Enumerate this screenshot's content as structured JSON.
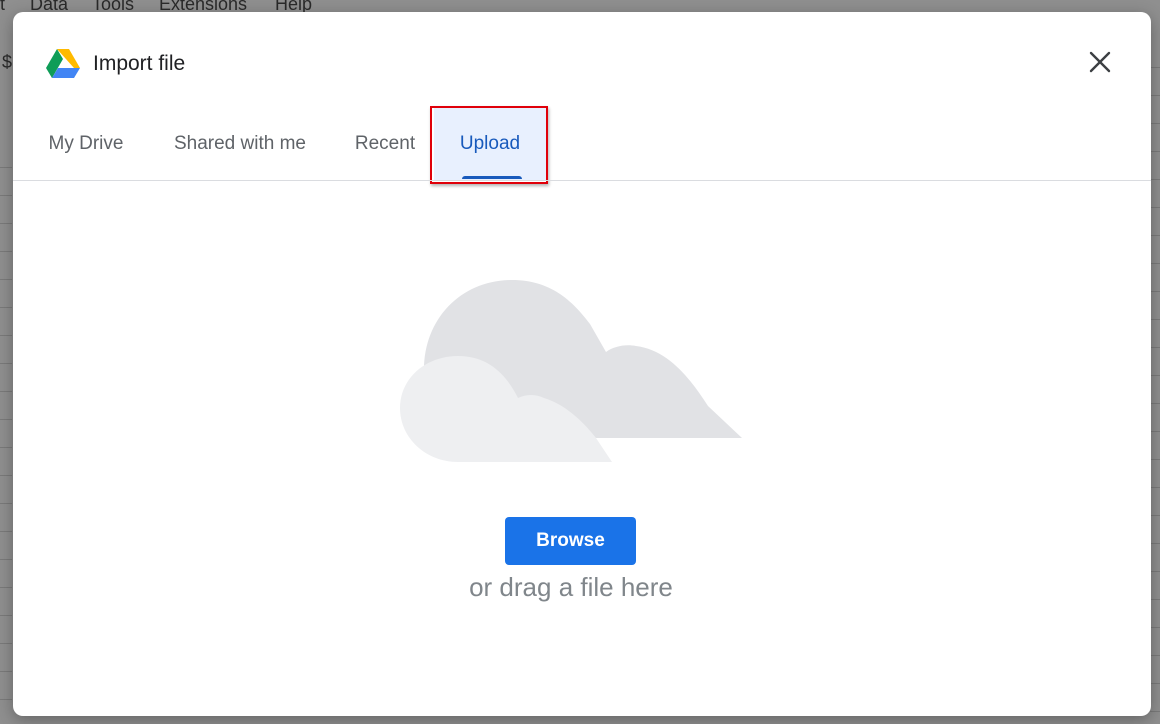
{
  "background_app": {
    "menu": [
      "t",
      "Data",
      "Tools",
      "Extensions",
      "Help"
    ],
    "side_glyph": "$"
  },
  "dialog": {
    "title": "Import file",
    "logo_icon": "google-drive-icon",
    "close_icon": "close-icon",
    "tabs": [
      {
        "label": "My Drive",
        "active": false
      },
      {
        "label": "Shared with me",
        "active": false
      },
      {
        "label": "Recent",
        "active": false
      },
      {
        "label": "Upload",
        "active": true
      }
    ],
    "upload": {
      "illustration": "cloud-illustration",
      "browse_label": "Browse",
      "drag_text": "or drag a file here"
    }
  },
  "colors": {
    "accent": "#1a73e8",
    "active_tab_text": "#185abc",
    "active_tab_bg": "#e8f0fe",
    "highlight_box": "#e0000a"
  }
}
